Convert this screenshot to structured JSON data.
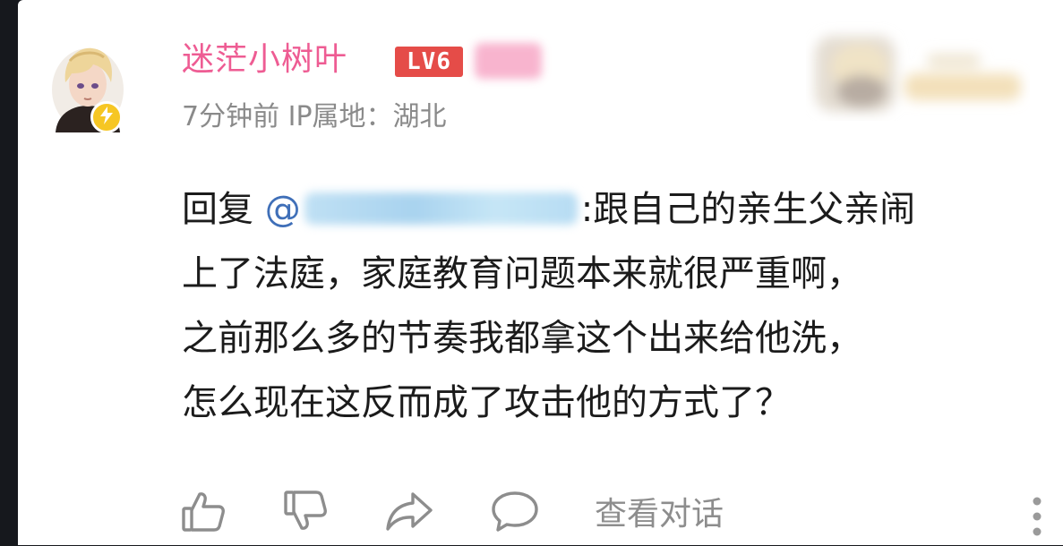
{
  "comment": {
    "user": {
      "name": "迷茫小树叶",
      "level": "LV6",
      "verified_icon": "lightning-icon"
    },
    "meta": "7分钟前 IP属地：湖北",
    "reply_prefix": "回复",
    "mention_at": "@",
    "lines": [
      ":跟自己的亲生父亲闹",
      "上了法庭，家庭教育问题本来就很严重啊，",
      "之前那么多的节奏我都拿这个出来给他洗，",
      "怎么现在这反而成了攻击他的方式了？"
    ]
  },
  "actions": {
    "like_icon": "thumbs-up-icon",
    "dislike_icon": "thumbs-down-icon",
    "share_icon": "share-icon",
    "reply_icon": "comment-bubble-icon",
    "view_conversation_label": "查看对话",
    "more_icon": "more-vertical-icon"
  },
  "colors": {
    "username": "#ee5c93",
    "level_badge": "#e54c48",
    "meta_text": "#8a8a8a",
    "mention": "#3f6fb8",
    "icon_gray": "#8d8d8d"
  }
}
